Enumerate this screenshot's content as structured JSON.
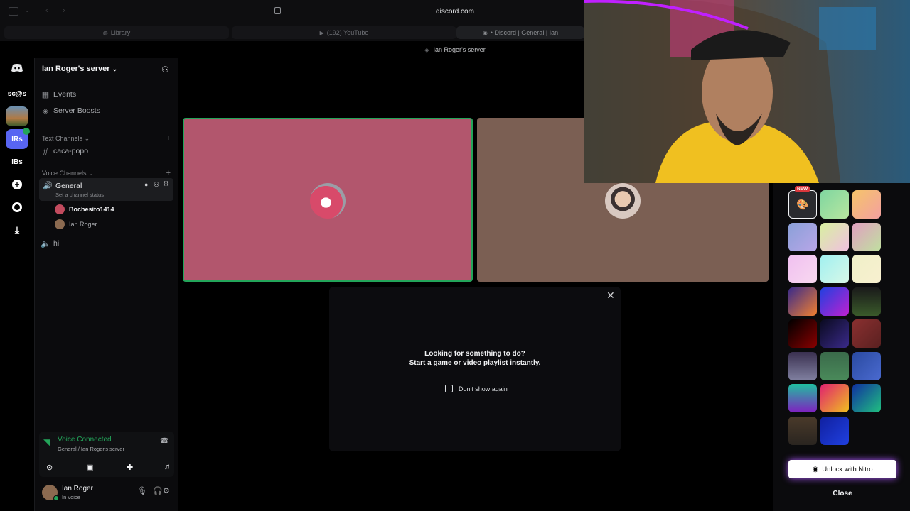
{
  "browser": {
    "url": "discord.com",
    "tabs": [
      {
        "label": "Library",
        "icon": "library-icon"
      },
      {
        "label": "(192) YouTube",
        "icon": "youtube-icon"
      },
      {
        "label": "• Discord | General | Ian",
        "icon": "discord-icon"
      }
    ]
  },
  "server_bar": {
    "title": "Ian Roger's server"
  },
  "rail": {
    "items": [
      {
        "label": "",
        "name": "discord-home"
      },
      {
        "label": "sc@s",
        "name": "server-scas"
      },
      {
        "label": "",
        "name": "server-image"
      },
      {
        "label": "IRs",
        "name": "server-irs"
      },
      {
        "label": "IBs",
        "name": "server-ibs"
      },
      {
        "label": "+",
        "name": "add-server"
      },
      {
        "label": "",
        "name": "discover"
      },
      {
        "label": "",
        "name": "download"
      }
    ]
  },
  "sidebar": {
    "server_name": "Ian Roger's server",
    "events": "Events",
    "boosts": "Server Boosts",
    "text_category": "Text Channels",
    "text_channels": [
      "caca-popo"
    ],
    "voice_category": "Voice Channels",
    "voice_channel": "General",
    "channel_status": "Set a channel status",
    "voice_users": [
      "Bochesito1414",
      "Ian Roger"
    ],
    "other_voice": "hi"
  },
  "voice_panel": {
    "status": "Voice Connected",
    "location": "General / Ian Roger's server"
  },
  "user_panel": {
    "name": "Ian Roger",
    "status": "In voice"
  },
  "popup": {
    "line1": "Looking for something to do?",
    "line2": "Start a game or video playlist instantly.",
    "checkbox": "Don't show again"
  },
  "picker": {
    "badge": "NEW",
    "unlock": "Unlock with Nitro",
    "close": "Close"
  },
  "colors": {
    "tile_left": "#b2566d",
    "tile_right": "#7b5f53",
    "accent_green": "#23a55a",
    "voice_green": "#57f287"
  }
}
